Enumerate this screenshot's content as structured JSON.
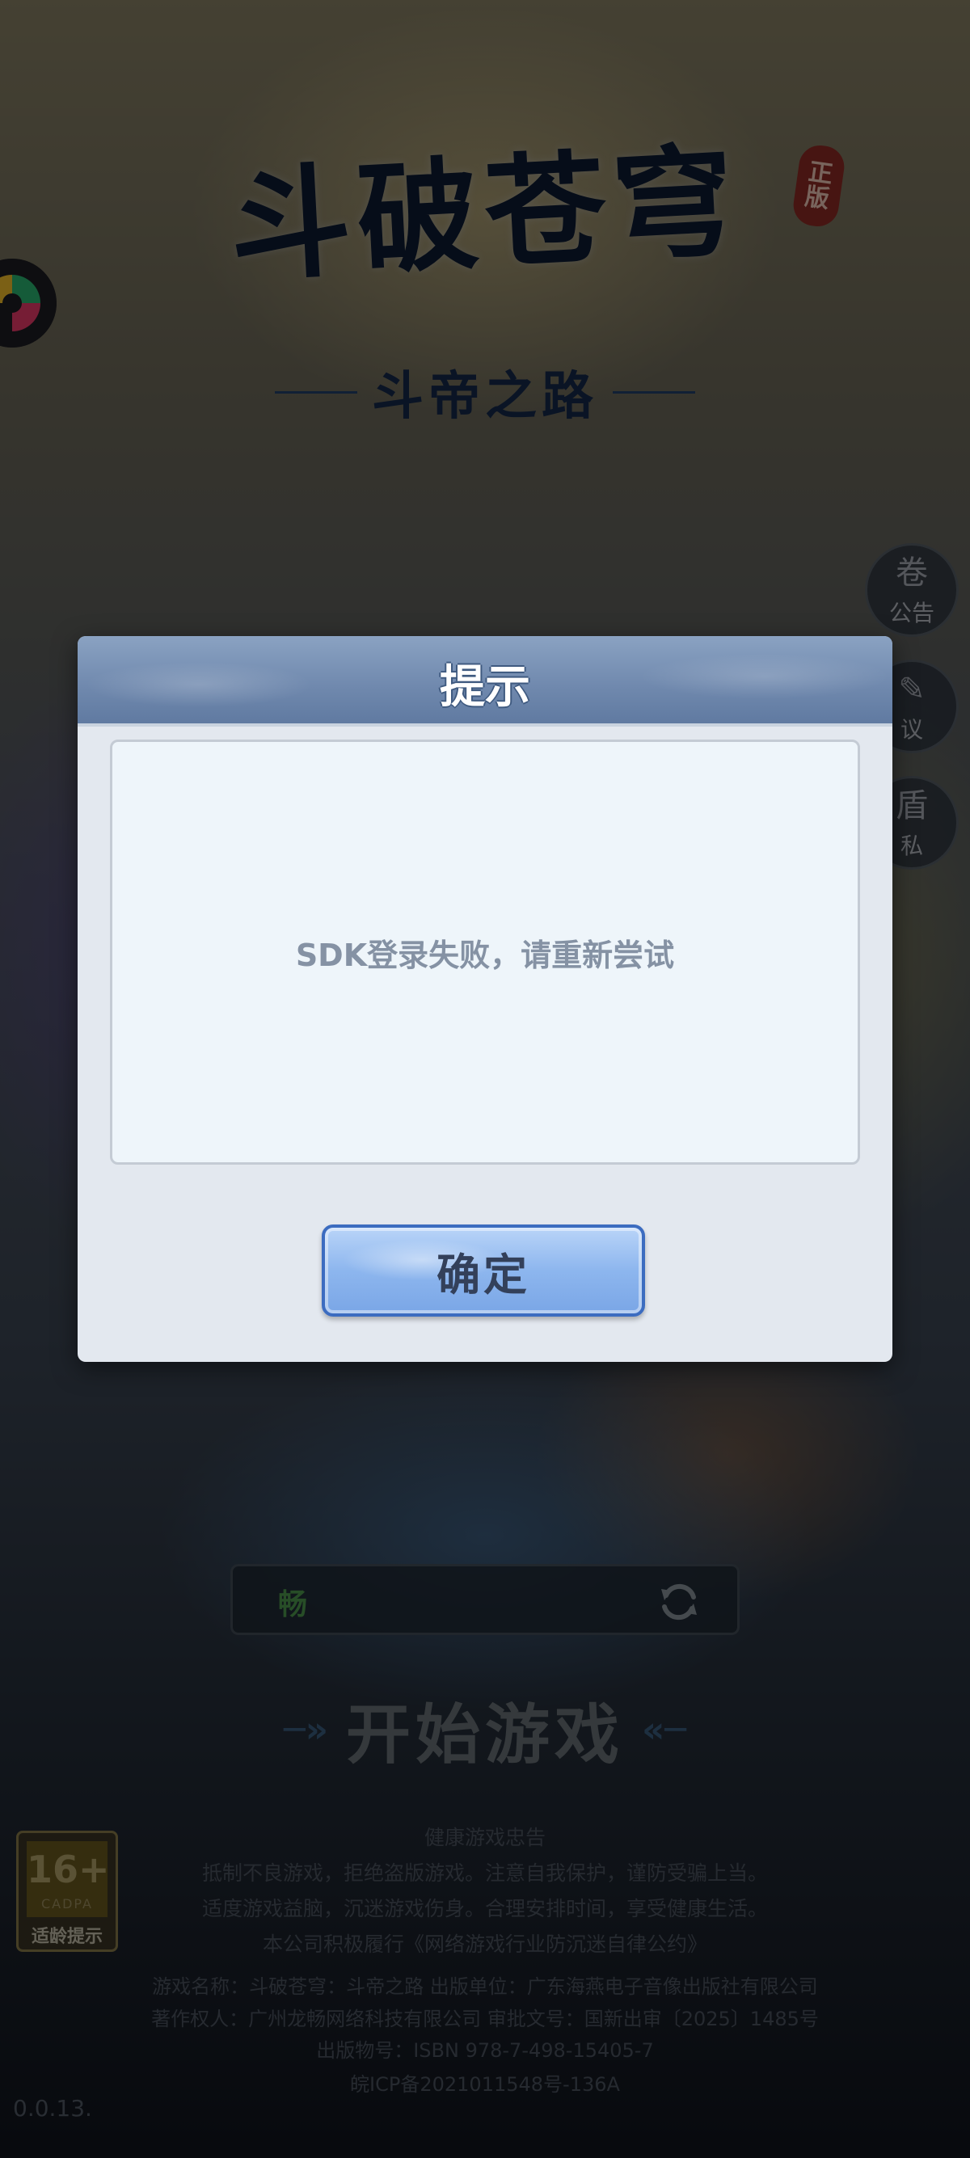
{
  "game": {
    "logo_title": "斗破苍穹",
    "logo_subtitle": "斗帝之路",
    "seal_text": [
      "正",
      "版"
    ]
  },
  "side_buttons": [
    {
      "label": "公告",
      "glyph": "卷"
    },
    {
      "label": "议",
      "glyph": "✎"
    },
    {
      "label": "私",
      "glyph": "盾"
    }
  ],
  "server": {
    "status": "畅"
  },
  "start_button": {
    "label": "开始游戏"
  },
  "age_rating": {
    "number": "16+",
    "org": "CADPA",
    "label": "适龄提示"
  },
  "health_notice": {
    "title": "健康游戏忠告",
    "lines": [
      "抵制不良游戏，拒绝盗版游戏。注意自我保护，谨防受骗上当。",
      "适度游戏益脑，沉迷游戏伤身。合理安排时间，享受健康生活。",
      "本公司积极履行《网络游戏行业防沉迷自律公约》"
    ]
  },
  "publish_info": {
    "line1": "游戏名称：斗破苍穹：斗帝之路    出版单位：广东海燕电子音像出版社有限公司",
    "line2": "著作权人：广州龙畅网络科技有限公司    审批文号：国新出审〔2025〕1485号",
    "isbn": "出版物号：ISBN 978-7-498-15405-7",
    "icp": "皖ICP备2021011548号-136A"
  },
  "version": "0.0.13.",
  "dialog": {
    "title": "提示",
    "message": "SDK登录失败，请重新尝试",
    "confirm_label": "确定"
  },
  "colors": {
    "dialog_header": "#6f88ad",
    "dialog_body": "#eef5fa",
    "confirm_button": "#8db6ee",
    "message_text": "#8592a4"
  }
}
